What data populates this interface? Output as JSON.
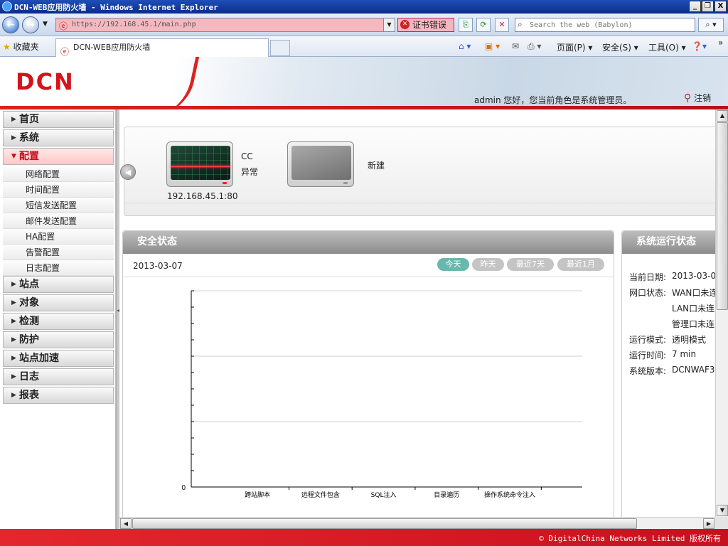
{
  "window": {
    "title": "DCN-WEB应用防火墙 - Windows Internet Explorer",
    "minimize": "_",
    "maximize": "❐",
    "close": "X"
  },
  "browser": {
    "url": "https://192.168.45.1/main.php",
    "cert_error": "证书错误",
    "search_placeholder": "Search the web (Babylon)",
    "favorites": "收藏夹",
    "tab_title": "DCN-WEB应用防火墙",
    "page_menu": "页面(P)",
    "safety_menu": "安全(S)",
    "tools_menu": "工具(O)"
  },
  "header": {
    "logo": "DCN",
    "welcome": "admin 您好，您当前角色是系统管理员。",
    "logout": "注销"
  },
  "sidebar": {
    "menus": [
      {
        "label": "首页"
      },
      {
        "label": "系统"
      },
      {
        "label": "配置",
        "active": true
      },
      {
        "label": "站点"
      },
      {
        "label": "对象"
      },
      {
        "label": "检测"
      },
      {
        "label": "防护"
      },
      {
        "label": "站点加速"
      },
      {
        "label": "日志"
      },
      {
        "label": "报表"
      }
    ],
    "config_subitems": [
      "网络配置",
      "时间配置",
      "短信发送配置",
      "邮件发送配置",
      "HA配置",
      "告警配置",
      "日志配置"
    ]
  },
  "devices": [
    {
      "name": "CC",
      "status": "异常",
      "address": "192.168.45.1:80"
    },
    {
      "name": "新建"
    }
  ],
  "security": {
    "title": "安全状态",
    "date": "2013-03-07",
    "ranges": [
      "今天",
      "昨天",
      "最近7天",
      "最近1月"
    ],
    "active_range": "今天"
  },
  "chart_data": {
    "type": "bar",
    "categories": [
      "跨站脚本",
      "远程文件包含",
      "SQL注入",
      "目录遍历",
      "操作系统命令注入"
    ],
    "values": [
      0,
      0,
      0,
      0,
      0
    ],
    "y_tick_labels": [
      "0"
    ],
    "grid": true
  },
  "system": {
    "title": "系统运行状态",
    "rows": [
      {
        "label": "当前日期:",
        "value": "2013-03-0"
      },
      {
        "label": "网口状态:",
        "value": "WAN口未连"
      },
      {
        "label": "",
        "value": "LAN口未连"
      },
      {
        "label": "",
        "value": "管理口未连"
      },
      {
        "label": "运行模式:",
        "value": "透明模式"
      },
      {
        "label": "运行时间:",
        "value": "7 min"
      },
      {
        "label": "系统版本:",
        "value": "DCNWAF3"
      }
    ]
  },
  "footer": {
    "copyright": "© DigitalChina Networks Limited 版权所有"
  }
}
